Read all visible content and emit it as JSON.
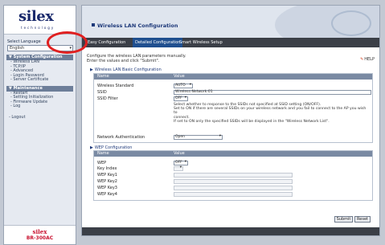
{
  "sidebar": {
    "brand": "silex",
    "brand_sub": "technology",
    "lang_label": "Select Language",
    "lang_value": "English",
    "sections": [
      {
        "title": "System Configuration",
        "items": [
          "Wireless LAN",
          "TCP/IP",
          "Advanced",
          "Login Password",
          "Server Certificate"
        ]
      },
      {
        "title": "Maintenance",
        "items": [
          "Restart",
          "Setting Initialization",
          "Firmware Update",
          "Log"
        ]
      }
    ],
    "logout": "Logout",
    "footer_brand": "silex",
    "footer_model": "BR-300AC"
  },
  "header": {
    "title": "Wireless LAN Configuration"
  },
  "tabs": [
    "Easy Configuration",
    "Detailed Configuration",
    "Smart Wireless Setup"
  ],
  "instructions": [
    "Configure the wireless LAN parameters manually.",
    "Enter the values and click \"Submit\"."
  ],
  "help": "HELP",
  "basic": {
    "title": "Wireless LAN Basic Configuration",
    "col_name": "Name",
    "col_value": "Value",
    "standard_label": "Wireless Standard",
    "standard_value": "AUTO",
    "ssid_label": "SSID",
    "ssid_value": "Wireless-Network-01",
    "filter_label": "SSID Filter",
    "filter_value": "OFF",
    "filter_desc": [
      "Select whether to response to the SSIDs not specified at SSID setting (ON/OFF).",
      "Set to ON if there are several SSIDs on your wireless network and you fail to connect to the AP you wish to",
      "connect.",
      "If set to ON only the specified SSIDs will be displayed in the \"Wireless Network List\"."
    ],
    "auth_label": "Network Authentication",
    "auth_value": "Open"
  },
  "wep": {
    "title": "WEP Configuration",
    "col_name": "Name",
    "col_value": "Value",
    "wep_label": "WEP",
    "wep_value": "OFF",
    "keyindex_label": "Key Index",
    "keys": [
      "WEP Key1",
      "WEP Key2",
      "WEP Key3",
      "WEP Key4"
    ]
  },
  "buttons": {
    "submit": "Submit",
    "reset": "Reset"
  }
}
